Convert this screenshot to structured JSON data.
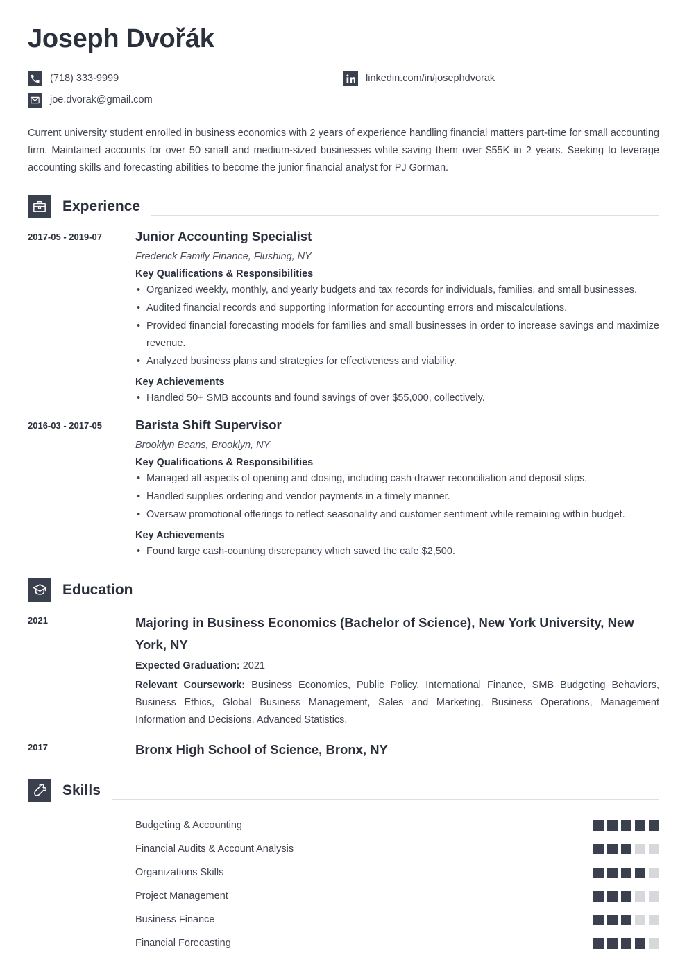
{
  "header": {
    "name": "Joseph Dvořák",
    "contacts": [
      {
        "icon": "phone-icon",
        "value": "(718) 333-9999"
      },
      {
        "icon": "linkedin-icon",
        "value": "linkedin.com/in/josephdvorak"
      },
      {
        "icon": "email-icon",
        "value": "joe.dvorak@gmail.com"
      }
    ]
  },
  "summary": "Current university student enrolled in business economics with 2 years of experience handling financial matters part-time for small accounting firm. Maintained accounts for over 50 small and medium-sized businesses while saving them over $55K in 2 years. Seeking to leverage accounting skills and forecasting abilities to become the junior financial analyst for PJ Gorman.",
  "sections": {
    "experience": {
      "title": "Experience",
      "icon": "briefcase-icon",
      "entries": [
        {
          "date": "2017-05 - 2019-07",
          "title": "Junior Accounting Specialist",
          "subtitle": "Frederick Family Finance, Flushing, NY",
          "qualifications_heading": "Key Qualifications & Responsibilities",
          "qualifications": [
            "Organized weekly, monthly, and yearly budgets and tax records for individuals, families, and small businesses.",
            "Audited financial records and supporting information for accounting errors and miscalculations.",
            "Provided financial forecasting models for families and small businesses in order to increase savings and maximize revenue.",
            "Analyzed business plans and strategies for effectiveness and viability."
          ],
          "achievements_heading": "Key Achievements",
          "achievements": [
            "Handled 50+ SMB accounts and found savings of over $55,000, collectively."
          ]
        },
        {
          "date": "2016-03 - 2017-05",
          "title": "Barista Shift Supervisor",
          "subtitle": "Brooklyn Beans, Brooklyn, NY",
          "qualifications_heading": "Key Qualifications & Responsibilities",
          "qualifications": [
            "Managed all aspects of opening and closing, including cash drawer reconciliation and deposit slips.",
            "Handled supplies ordering and vendor payments in a timely manner.",
            "Oversaw promotional offerings to reflect seasonality and customer sentiment while remaining within budget."
          ],
          "achievements_heading": "Key Achievements",
          "achievements": [
            "Found large cash-counting discrepancy which saved the cafe $2,500."
          ]
        }
      ]
    },
    "education": {
      "title": "Education",
      "icon": "graduation-cap-icon",
      "entries": [
        {
          "date": "2021",
          "title": "Majoring in Business Economics (Bachelor of Science),   New York University, New York, NY",
          "graduation_label": "Expected Graduation:",
          "graduation_value": "2021",
          "coursework_label": "Relevant Coursework:",
          "coursework_value": "Business Economics, Public Policy, International Finance, SMB Budgeting Behaviors, Business Ethics, Global Business Management, Sales and Marketing, Business Operations, Management Information and Decisions, Advanced Statistics."
        },
        {
          "date": "2017",
          "title": "Bronx High School of Science, Bronx, NY"
        }
      ]
    },
    "skills": {
      "title": "Skills",
      "icon": "puzzle-piece-icon",
      "max_rating": 5,
      "items": [
        {
          "name": "Budgeting & Accounting",
          "rating": 5
        },
        {
          "name": "Financial Audits & Account Analysis",
          "rating": 3
        },
        {
          "name": "Organizations Skills",
          "rating": 4
        },
        {
          "name": "Project Management",
          "rating": 3
        },
        {
          "name": "Business Finance",
          "rating": 3
        },
        {
          "name": "Financial Forecasting",
          "rating": 4
        }
      ]
    }
  },
  "colors": {
    "dark": "#3a404e",
    "heading": "#2b303c",
    "body": "#3f444f",
    "rule": "#dcdee2",
    "rating_off": "#d6d8dc"
  }
}
